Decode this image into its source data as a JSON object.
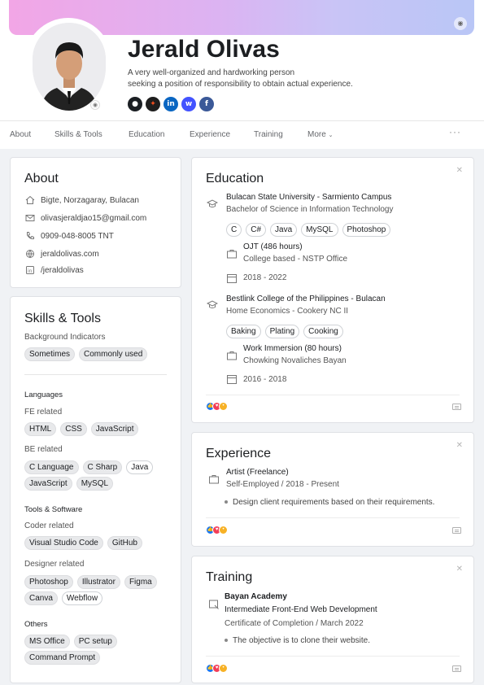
{
  "profile": {
    "name": "Jerald Olivas",
    "tagline_1": "A very well-organized and hardworking person",
    "tagline_2": "seeking a position of responsibility to obtain actual experience.",
    "socials": [
      {
        "icon": "github-icon",
        "color": "#1b1f23"
      },
      {
        "icon": "figma-icon",
        "color": "#1e1e1e"
      },
      {
        "icon": "linkedin-icon",
        "color": "#0a66c2"
      },
      {
        "icon": "webflow-icon",
        "color": "#4353ff"
      },
      {
        "icon": "facebook-icon",
        "color": "#3b5998"
      }
    ]
  },
  "nav": {
    "about": "About",
    "skills": "Skills  & Tools",
    "education": "Education",
    "experience": "Experience",
    "training": "Training",
    "more": "More",
    "dots": "···"
  },
  "about": {
    "title": "About",
    "location": "Bigte, Norzagaray, Bulacan",
    "email": "olivasjeraldjao15@gmail.com",
    "phone": "0909-048-8005  TNT",
    "website": "jeraldolivas.com",
    "linkedin": "/jeraldolivas"
  },
  "skills": {
    "title": "Skills & Tools",
    "background_label": "Background Indicators",
    "indicator_sometimes": "Sometimes",
    "indicator_common": "Commonly used",
    "languages_label": "Languages",
    "fe_label": "FE related",
    "fe": [
      "HTML",
      "CSS",
      "JavaScript"
    ],
    "be_label": "BE related",
    "be_row1": [
      "C Language",
      "C Sharp",
      "Java"
    ],
    "be_row2": [
      "JavaScript",
      "MySQL"
    ],
    "tools_label": "Tools & Software",
    "coder_label": "Coder related",
    "coder": [
      "Visual Studio Code",
      "GitHub"
    ],
    "designer_label": "Designer related",
    "designer_row1": [
      "Photoshop",
      "Illustrator",
      "Figma"
    ],
    "designer_row2": [
      "Canva",
      "Webflow"
    ],
    "others_label": "Others",
    "others_row1": [
      "MS Office",
      "PC setup"
    ],
    "others_row2": [
      "Command Prompt"
    ]
  },
  "education": {
    "title": "Education",
    "school1": "Bulacan State University - Sarmiento Campus",
    "degree1": "Bachelor of Science in Information Technology",
    "chips1": [
      "C",
      "C#",
      "Java",
      "MySQL",
      "Photoshop"
    ],
    "ojt_title": "OJT (486 hours)",
    "ojt_sub": "College based - NSTP Office",
    "years1": "2018 - 2022",
    "school2": "Bestlink College of the Philippines - Bulacan",
    "degree2": "Home Economics - Cookery NC II",
    "chips2": [
      "Baking",
      "Plating",
      "Cooking"
    ],
    "immersion_title": "Work Immersion (80 hours)",
    "immersion_sub": "Chowking Novaliches Bayan",
    "years2": "2016 - 2018"
  },
  "experience": {
    "title": "Experience",
    "role": "Artist (Freelance)",
    "sub": "Self-Employed / 2018 - Present",
    "bullet": "Design client requirements based on their requirements."
  },
  "training": {
    "title": "Training",
    "org": "Bayan Academy",
    "course": "Intermediate Front-End Web Development",
    "cert": "Certificate of Completion / March 2022",
    "bullet": "The objective is to clone their website."
  }
}
